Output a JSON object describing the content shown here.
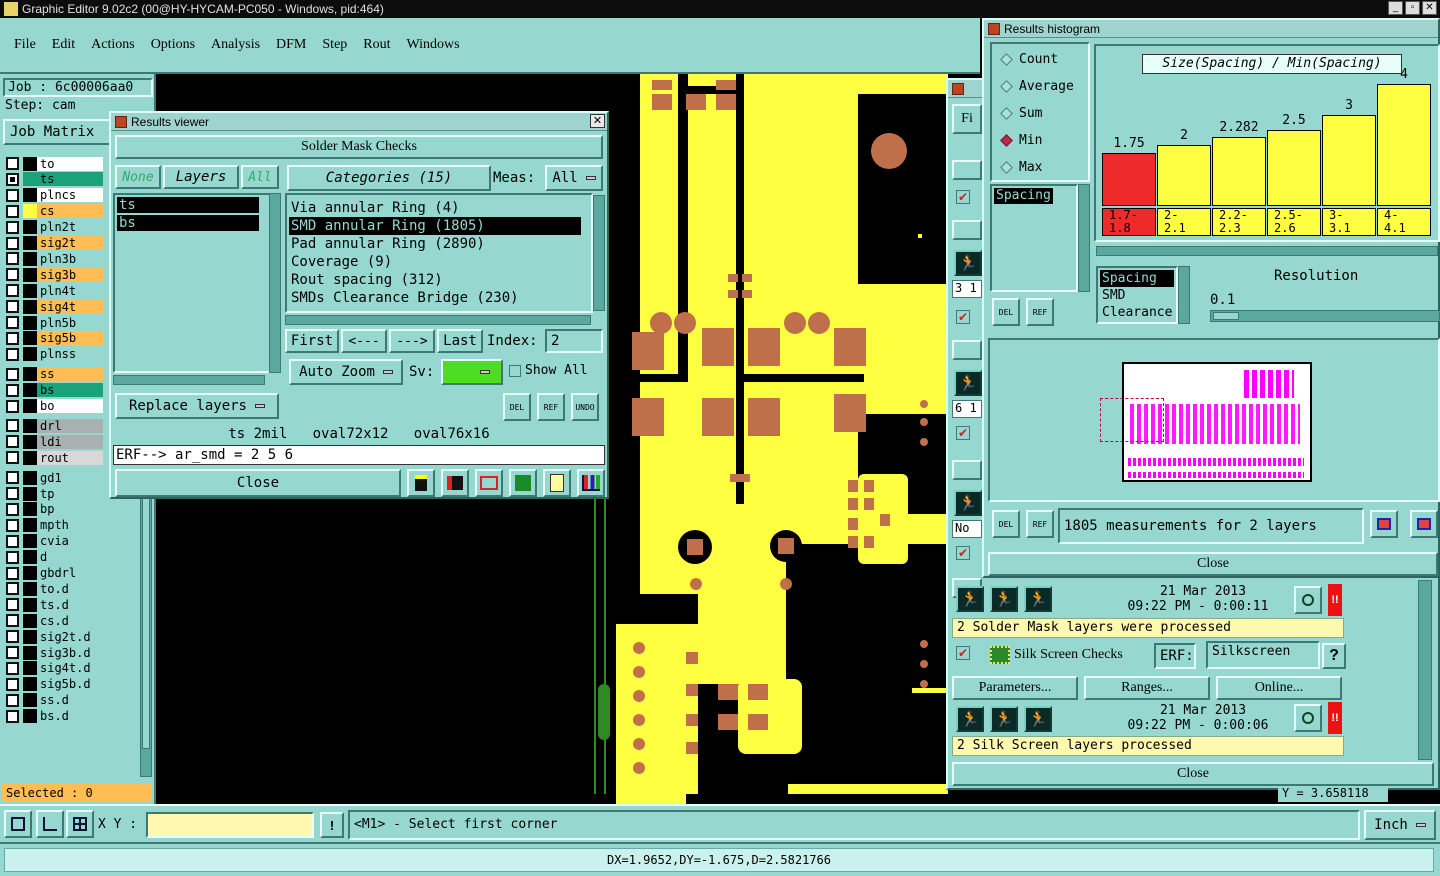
{
  "app": {
    "title": "Graphic Editor 9.02c2 (00@HY-HYCAM-PC050 - Windows, pid:464)"
  },
  "menu": [
    "File",
    "Edit",
    "Actions",
    "Options",
    "Analysis",
    "DFM",
    "Step",
    "Rout",
    "Windows"
  ],
  "left_panel": {
    "job": "Job : 6c00006aa0",
    "step": "Step: cam",
    "job_matrix_label": "Job Matrix",
    "layers": [
      {
        "name": "to",
        "color": "#ffffff",
        "checked": false
      },
      {
        "name": "ts",
        "color": "#1aa37a",
        "checked": true
      },
      {
        "name": "plncs",
        "color": "#ffffff",
        "checked": false
      },
      {
        "name": "cs",
        "color": "#ffbd54",
        "checked": false
      },
      {
        "name": "pln2t",
        "color": "#96d8d0",
        "checked": false
      },
      {
        "name": "sig2t",
        "color": "#ffbd54",
        "checked": false
      },
      {
        "name": "pln3b",
        "color": "#96d8d0",
        "checked": false
      },
      {
        "name": "sig3b",
        "color": "#ffbd54",
        "checked": false
      },
      {
        "name": "pln4t",
        "color": "#96d8d0",
        "checked": false
      },
      {
        "name": "sig4t",
        "color": "#ffbd54",
        "checked": false
      },
      {
        "name": "pln5b",
        "color": "#96d8d0",
        "checked": false
      },
      {
        "name": "sig5b",
        "color": "#ffbd54",
        "checked": false
      },
      {
        "name": "plnss",
        "color": "#96d8d0",
        "checked": false
      },
      {
        "name": "ss",
        "color": "#ffbd54",
        "checked": false
      },
      {
        "name": "bs",
        "color": "#1aa37a",
        "checked": false
      },
      {
        "name": "bo",
        "color": "#ffffff",
        "checked": false
      },
      {
        "name": "drl",
        "color": "#a8b0b0",
        "checked": false
      },
      {
        "name": "ldi",
        "color": "#a8b0b0",
        "checked": false
      },
      {
        "name": "rout",
        "color": "#d8d8d8",
        "checked": false
      },
      {
        "name": "gd1",
        "color": "#96d8d0",
        "checked": false
      },
      {
        "name": "tp",
        "color": "#96d8d0",
        "checked": false
      },
      {
        "name": "bp",
        "color": "#96d8d0",
        "checked": false
      },
      {
        "name": "mpth",
        "color": "#96d8d0",
        "checked": false
      },
      {
        "name": "cvia",
        "color": "#96d8d0",
        "checked": false
      },
      {
        "name": "d",
        "color": "#96d8d0",
        "checked": false
      },
      {
        "name": "gbdrl",
        "color": "#96d8d0",
        "checked": false
      },
      {
        "name": "to.d",
        "color": "#96d8d0",
        "checked": false
      },
      {
        "name": "ts.d",
        "color": "#96d8d0",
        "checked": false
      },
      {
        "name": "cs.d",
        "color": "#96d8d0",
        "checked": false
      },
      {
        "name": "sig2t.d",
        "color": "#96d8d0",
        "checked": false
      },
      {
        "name": "sig3b.d",
        "color": "#96d8d0",
        "checked": false
      },
      {
        "name": "sig4t.d",
        "color": "#96d8d0",
        "checked": false
      },
      {
        "name": "sig5b.d",
        "color": "#96d8d0",
        "checked": false
      },
      {
        "name": "ss.d",
        "color": "#96d8d0",
        "checked": false
      },
      {
        "name": "bs.d",
        "color": "#96d8d0",
        "checked": false
      }
    ],
    "selected": "Selected : 0"
  },
  "results_viewer": {
    "title": "Results viewer",
    "header": "Solder Mask Checks",
    "none_btn": "None",
    "layers_btn": "Layers",
    "all_btn": "All",
    "categories_btn": "Categories (15)",
    "meas_label": "Meas:",
    "meas_value": "All",
    "layer_list": [
      "ts",
      "bs"
    ],
    "categories": [
      "Via annular Ring (4)",
      "SMD annular Ring (1805)",
      "Pad annular Ring (2890)",
      "Coverage (9)",
      "Rout spacing (312)",
      "SMDs Clearance Bridge (230)"
    ],
    "selected_category": 1,
    "first_btn": "First",
    "prev_btn": "<---",
    "next_btn": "--->",
    "last_btn": "Last",
    "index_label": "Index:",
    "index_value": "2",
    "auto_zoom": "Auto Zoom",
    "sv_label": "Sv:",
    "show_all": "Show All",
    "replace_layers": "Replace layers",
    "del_label": "DEL",
    "ref_label": "REF",
    "undo_label": "UNDO",
    "info_line": "ts 2mil   oval72x12   oval76x16",
    "erf_line": "ERF--> ar_smd = 2 5 6",
    "close": "Close"
  },
  "histogram": {
    "title": "Results histogram",
    "modes": [
      "Count",
      "Average",
      "Sum",
      "Min",
      "Max"
    ],
    "selected_mode": "Min",
    "chart_title": "Size(Spacing) / Min(Spacing)",
    "list_top": [
      "Spacing"
    ],
    "list_bottom": [
      "Spacing",
      "SMD",
      "Clearance"
    ],
    "resolution_label": "Resolution",
    "resolution_value": "0.1",
    "measurements_text": "1805 measurements for 2 layers",
    "close": "Close"
  },
  "chart_data": {
    "type": "bar",
    "title": "Size(Spacing) / Min(Spacing)",
    "categories": [
      "1.7-\n1.8",
      "2-\n2.1",
      "2.2-\n2.3",
      "2.5-\n2.6",
      "3-\n3.1",
      "4-\n4.1"
    ],
    "values": [
      1.75,
      2,
      2.282,
      2.5,
      3,
      4
    ],
    "value_labels": [
      "1.75",
      "2",
      "2.282",
      "2.5",
      "3",
      "4"
    ],
    "colors": [
      "#ee2a2a",
      "#ffff42",
      "#ffff42",
      "#ffff42",
      "#ffff42",
      "#ffff42"
    ],
    "ylim": [
      0,
      4
    ]
  },
  "checklist": {
    "sm_date": "21 Mar 2013",
    "sm_time": "09:22 PM - 0:00:11",
    "sm_status": "2 Solder Mask layers were processed",
    "silk_title": "Silk Screen Checks",
    "erf_label": "ERF:",
    "erf_value": "Silkscreen",
    "params_btn": "Parameters...",
    "ranges_btn": "Ranges...",
    "online_btn": "Online...",
    "silk_date": "21 Mar 2013",
    "silk_time": "09:22 PM - 0:00:06",
    "silk_status": "2 Silk Screen layers processed",
    "close": "Close",
    "side_labels": [
      "Fi",
      "3 1",
      "6 1",
      "No"
    ]
  },
  "bottom": {
    "xy_label": "X Y :",
    "prompt": "<M1> - Select first corner",
    "unit": "Inch",
    "status": "DX=1.9652,DY=-1.675,D=2.5821766",
    "coord_fragment": "Y = 3.658118"
  }
}
